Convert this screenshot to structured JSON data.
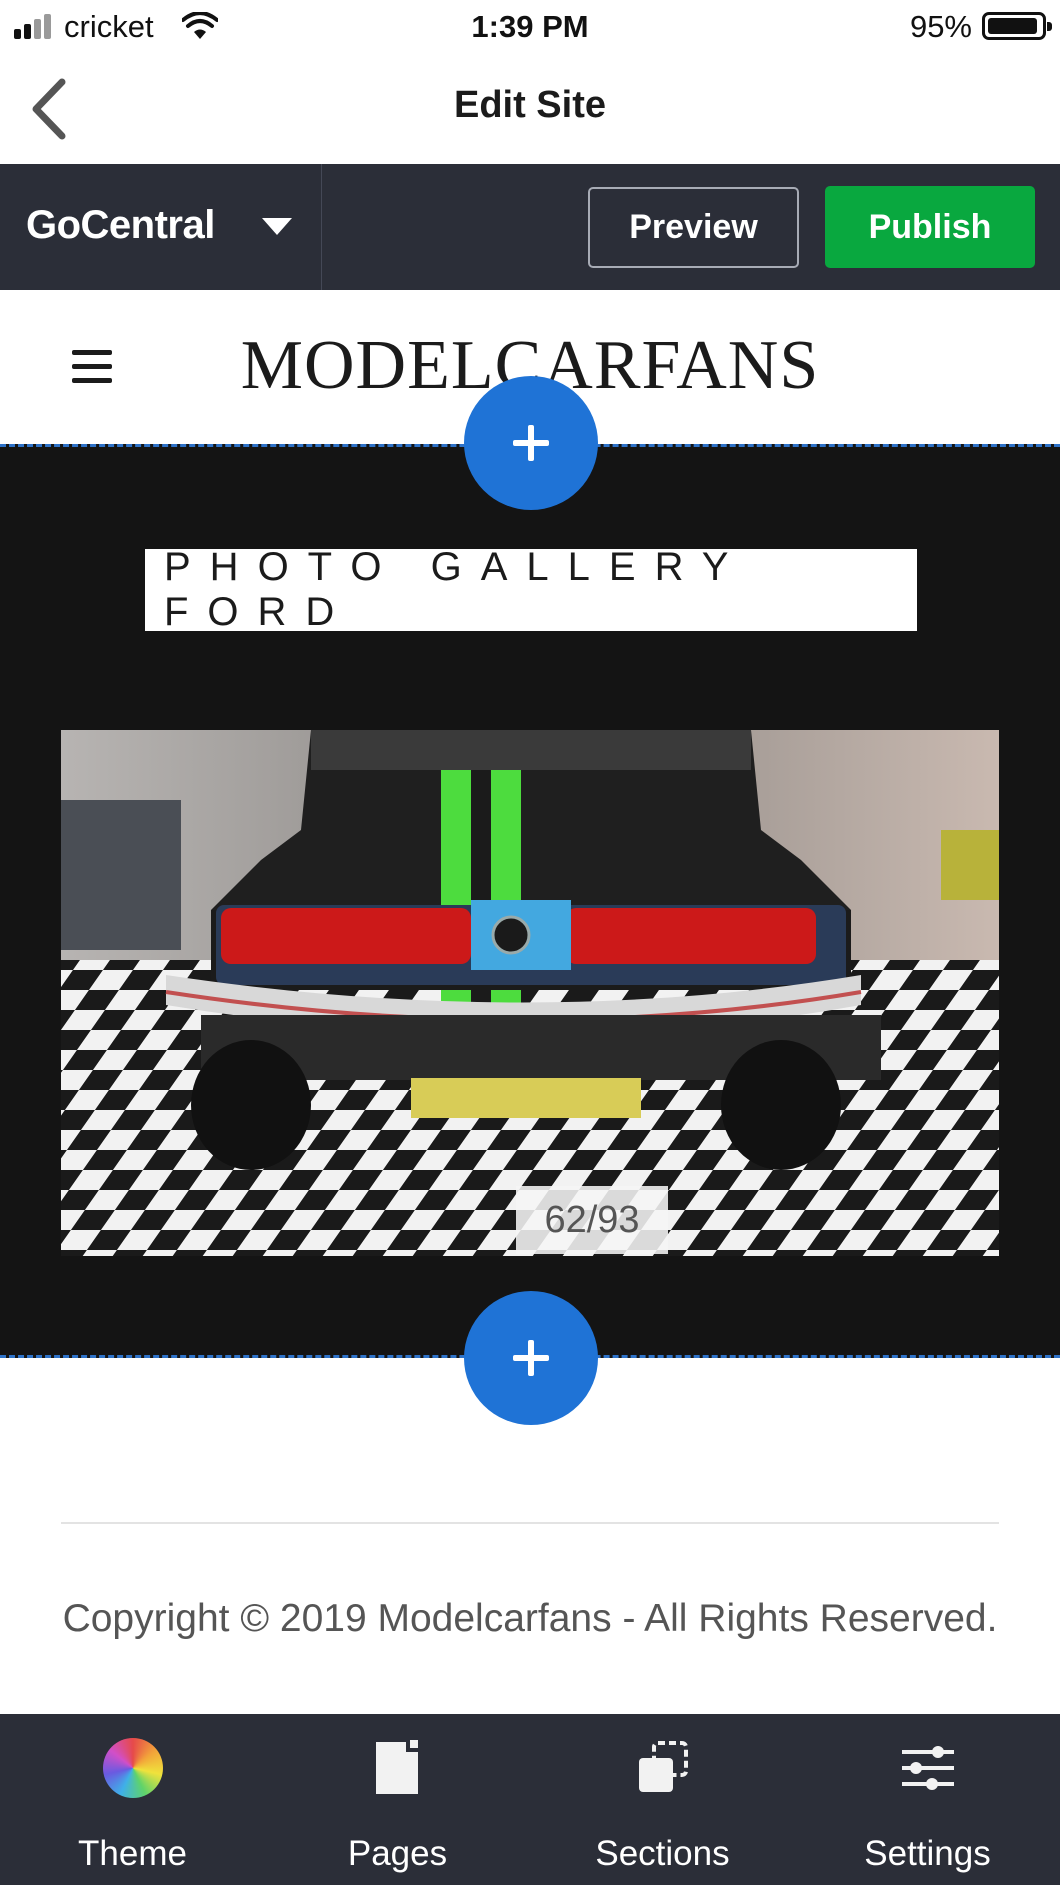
{
  "status_bar": {
    "carrier": "cricket",
    "time": "1:39 PM",
    "battery_percent": "95%",
    "battery_level": 0.95
  },
  "nav": {
    "title": "Edit Site",
    "back_icon": "chevron-left-icon"
  },
  "toolbar": {
    "brand": "GoCentral",
    "brand_icon": "caret-down-icon",
    "preview_label": "Preview",
    "publish_label": "Publish",
    "publish_color": "#09a83f"
  },
  "site_header": {
    "menu_icon": "hamburger-menu-icon",
    "logo_text": "MODELCARFANS"
  },
  "gallery": {
    "title": "PHOTO GALLERY FORD",
    "counter": "62/93",
    "add_icon": "plus-icon",
    "accent_color": "#1f73d6"
  },
  "footer": {
    "copyright": "Copyright © 2019 Modelcarfans  - All Rights Reserved."
  },
  "tab_bar": {
    "tabs": [
      {
        "label": "Theme",
        "icon": "color-wheel-icon"
      },
      {
        "label": "Pages",
        "icon": "page-icon"
      },
      {
        "label": "Sections",
        "icon": "sections-icon"
      },
      {
        "label": "Settings",
        "icon": "sliders-icon"
      }
    ]
  }
}
